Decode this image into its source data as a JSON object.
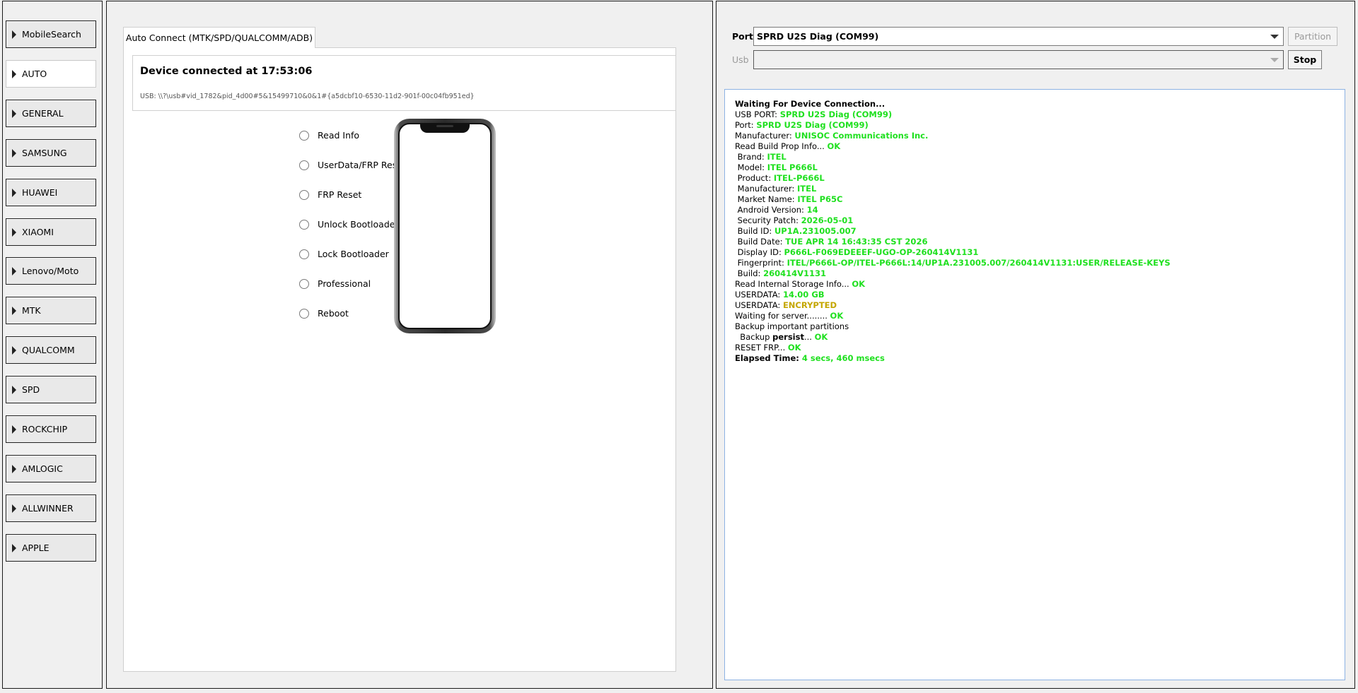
{
  "sidebar": {
    "items": [
      {
        "label": "MobileSearch",
        "active": false
      },
      {
        "label": "AUTO",
        "active": true
      },
      {
        "label": "GENERAL",
        "active": false
      },
      {
        "label": "SAMSUNG",
        "active": false
      },
      {
        "label": "HUAWEI",
        "active": false
      },
      {
        "label": "XIAOMI",
        "active": false
      },
      {
        "label": "Lenovo/Moto",
        "active": false
      },
      {
        "label": "MTK",
        "active": false
      },
      {
        "label": "QUALCOMM",
        "active": false
      },
      {
        "label": "SPD",
        "active": false
      },
      {
        "label": "ROCKCHIP",
        "active": false
      },
      {
        "label": "AMLOGIC",
        "active": false
      },
      {
        "label": "ALLWINNER",
        "active": false
      },
      {
        "label": "APPLE",
        "active": false
      }
    ]
  },
  "center": {
    "tab_label": "Auto Connect (MTK/SPD/QUALCOMM/ADB)",
    "device_title": "Device connected at 17:53:06",
    "device_usb": "USB: \\\\?\\usb#vid_1782&pid_4d00#5&15499710&0&1#{a5dcbf10-6530-11d2-901f-00c04fb951ed}",
    "options": [
      "Read Info",
      "UserData/FRP Reset",
      "FRP Reset",
      "Unlock Bootloader",
      "Lock Bootloader",
      "Professional",
      "Reboot"
    ]
  },
  "right": {
    "port_label": "Port",
    "port_value": "SPRD U2S Diag (COM99)",
    "usb_label": "Usb",
    "usb_value": "",
    "partition_label": "Partition",
    "stop_label": "Stop"
  },
  "log": {
    "lines": [
      [
        {
          "t": "Waiting For Device Connection...",
          "c": "b"
        }
      ],
      [
        {
          "t": "USB PORT: ",
          "c": ""
        },
        {
          "t": "SPRD U2S Diag (COM99)",
          "c": "g"
        }
      ],
      [
        {
          "t": "Port: ",
          "c": ""
        },
        {
          "t": "SPRD U2S Diag (COM99)",
          "c": "g"
        }
      ],
      [
        {
          "t": "Manufacturer: ",
          "c": ""
        },
        {
          "t": "UNISOC Communications Inc.",
          "c": "g"
        }
      ],
      [
        {
          "t": "Read Build Prop Info... ",
          "c": ""
        },
        {
          "t": "OK",
          "c": "g"
        }
      ],
      [
        {
          "t": " Brand: ",
          "c": ""
        },
        {
          "t": "ITEL",
          "c": "g"
        }
      ],
      [
        {
          "t": " Model: ",
          "c": ""
        },
        {
          "t": "ITEL P666L",
          "c": "g"
        }
      ],
      [
        {
          "t": " Product: ",
          "c": ""
        },
        {
          "t": "ITEL-P666L",
          "c": "g"
        }
      ],
      [
        {
          "t": " Manufacturer: ",
          "c": ""
        },
        {
          "t": "ITEL",
          "c": "g"
        }
      ],
      [
        {
          "t": " Market Name: ",
          "c": ""
        },
        {
          "t": "ITEL P65C",
          "c": "g"
        }
      ],
      [
        {
          "t": " Android Version: ",
          "c": ""
        },
        {
          "t": "14",
          "c": "g"
        }
      ],
      [
        {
          "t": " Security Patch: ",
          "c": ""
        },
        {
          "t": "2026-05-01",
          "c": "g"
        }
      ],
      [
        {
          "t": " Build ID: ",
          "c": ""
        },
        {
          "t": "UP1A.231005.007",
          "c": "g"
        }
      ],
      [
        {
          "t": " Build Date: ",
          "c": ""
        },
        {
          "t": "TUE APR 14 16:43:35 CST 2026",
          "c": "g"
        }
      ],
      [
        {
          "t": " Display ID: ",
          "c": ""
        },
        {
          "t": "P666L-F069EDEEEF-UGO-OP-260414V1131",
          "c": "g"
        }
      ],
      [
        {
          "t": " Fingerprint: ",
          "c": ""
        },
        {
          "t": "ITEL/P666L-OP/ITEL-P666L:14/UP1A.231005.007/260414V1131:USER/RELEASE-KEYS",
          "c": "g"
        }
      ],
      [
        {
          "t": " Build: ",
          "c": ""
        },
        {
          "t": "260414V1131",
          "c": "g"
        }
      ],
      [
        {
          "t": "Read Internal Storage Info... ",
          "c": ""
        },
        {
          "t": "OK",
          "c": "g"
        }
      ],
      [
        {
          "t": "USERDATA: ",
          "c": ""
        },
        {
          "t": "14.00 GB",
          "c": "g"
        }
      ],
      [
        {
          "t": "USERDATA: ",
          "c": ""
        },
        {
          "t": "ENCRYPTED",
          "c": "y"
        }
      ],
      [
        {
          "t": "Waiting for server........ ",
          "c": ""
        },
        {
          "t": "OK",
          "c": "g"
        }
      ],
      [
        {
          "t": "Backup important partitions",
          "c": ""
        }
      ],
      [
        {
          "t": "  Backup ",
          "c": ""
        },
        {
          "t": "persist",
          "c": "b"
        },
        {
          "t": "... ",
          "c": ""
        },
        {
          "t": "OK",
          "c": "g"
        }
      ],
      [
        {
          "t": "RESET FRP... ",
          "c": ""
        },
        {
          "t": "OK",
          "c": "g"
        }
      ],
      [
        {
          "t": "Elapsed Time: ",
          "c": "b"
        },
        {
          "t": "4 secs, 460 msecs",
          "c": "g"
        }
      ]
    ]
  },
  "colors": {
    "ok_green": "#1fe01f",
    "warn_yellow": "#c4a600",
    "log_border": "#8db2e3"
  }
}
